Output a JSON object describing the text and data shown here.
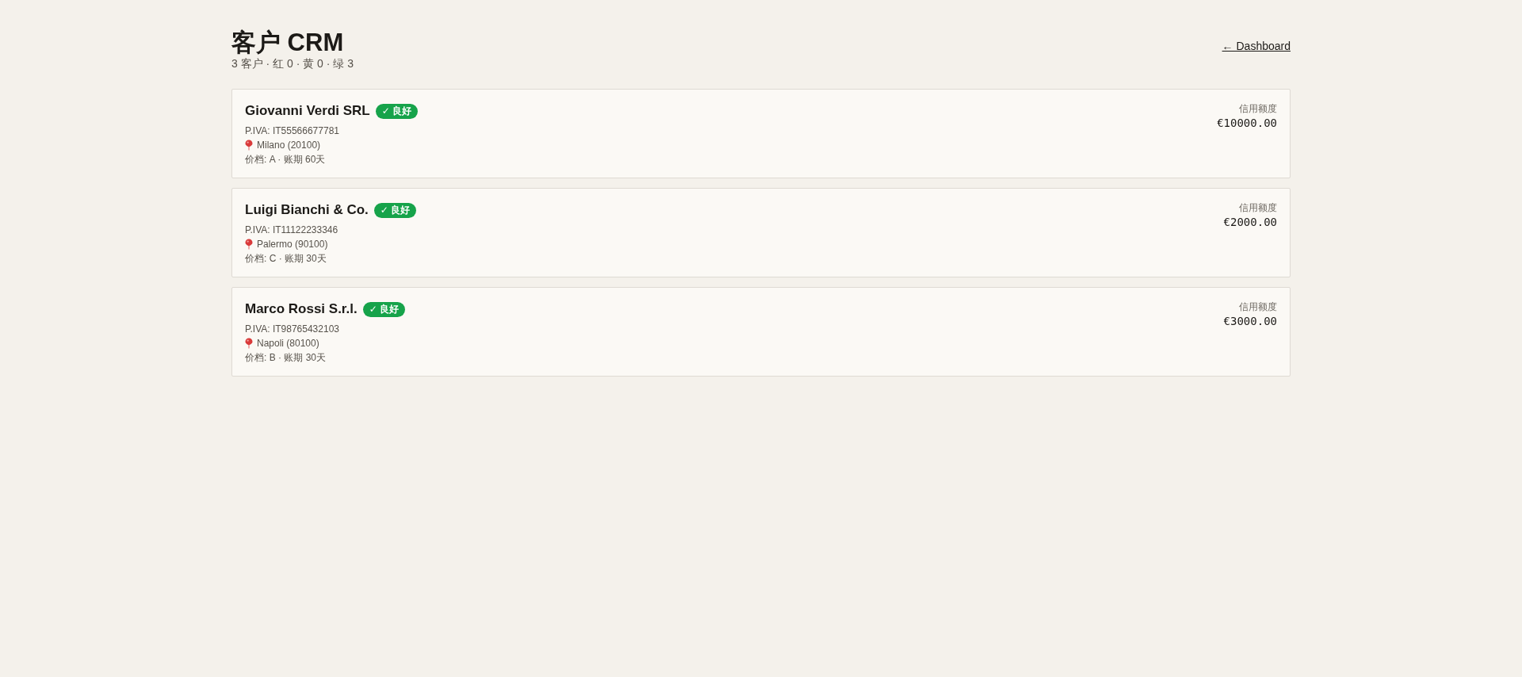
{
  "header": {
    "title": "客户 CRM",
    "summary": "3 客户 · 红 0 · 黄 0 · 绿 3",
    "back_link": "← Dashboard"
  },
  "customers": [
    {
      "name": "Giovanni Verdi SRL",
      "badge": {
        "text": "✓ 良好",
        "color": "#16a34a"
      },
      "vat": "P.IVA: IT55566677781",
      "location": "Milano (20100)",
      "terms": "价档: A · 账期 60天",
      "credit_label": "信用额度",
      "credit": "€10000.00"
    },
    {
      "name": "Luigi Bianchi & Co.",
      "badge": {
        "text": "✓ 良好",
        "color": "#16a34a"
      },
      "vat": "P.IVA: IT11122233346",
      "location": "Palermo (90100)",
      "terms": "价档: C · 账期 30天",
      "credit_label": "信用额度",
      "credit": "€2000.00"
    },
    {
      "name": "Marco Rossi S.r.l.",
      "badge": {
        "text": "✓ 良好",
        "color": "#16a34a"
      },
      "vat": "P.IVA: IT98765432103",
      "location": "Napoli (80100)",
      "terms": "价档: B · 账期 30天",
      "credit_label": "信用额度",
      "credit": "€3000.00"
    }
  ]
}
